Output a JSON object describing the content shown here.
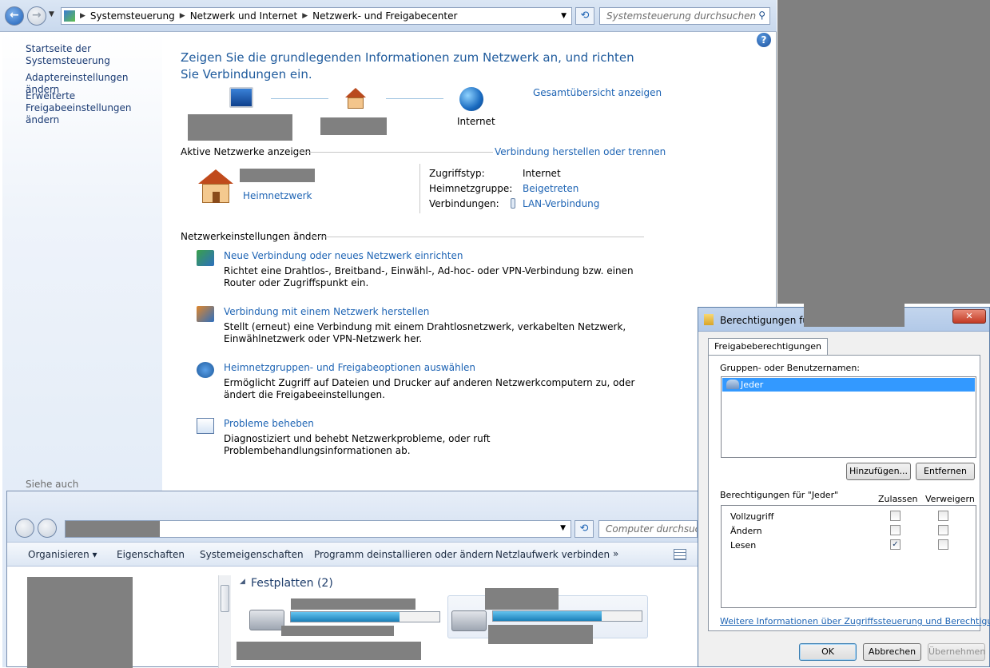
{
  "addressbar": {
    "crumbs": [
      "Systemsteuerung",
      "Netzwerk und Internet",
      "Netzwerk- und Freigabecenter"
    ],
    "search_placeholder": "Systemsteuerung durchsuchen"
  },
  "sidebar": {
    "items": [
      {
        "label": "Startseite der Systemsteuerung"
      },
      {
        "label": "Adaptereinstellungen ändern"
      },
      {
        "label": "Erweiterte\nFreigabeeinstellungen ändern"
      }
    ],
    "see_also_label": "Siehe auch"
  },
  "main": {
    "heading": "Zeigen Sie die grundlegenden Informationen zum Netzwerk an, und richten Sie Verbindungen ein.",
    "map_internet_label": "Internet",
    "map_overview_link": "Gesamtübersicht anzeigen",
    "active_networks_header": "Aktive Netzwerke anzeigen",
    "connect_link": "Verbindung herstellen oder trennen",
    "network_type": "Heimnetzwerk",
    "details": {
      "access_type_label": "Zugriffstyp:",
      "access_type_value": "Internet",
      "homegroup_label": "Heimnetzgruppe:",
      "homegroup_value": "Beigetreten",
      "connections_label": "Verbindungen:",
      "connections_value": "LAN-Verbindung"
    },
    "settings_header": "Netzwerkeinstellungen ändern",
    "tasks": [
      {
        "title": "Neue Verbindung oder neues Netzwerk einrichten",
        "desc": "Richtet eine Drahtlos-, Breitband-, Einwähl-, Ad-hoc- oder VPN-Verbindung bzw. einen Router oder Zugriffspunkt ein."
      },
      {
        "title": "Verbindung mit einem Netzwerk herstellen",
        "desc": "Stellt (erneut) eine Verbindung mit einem Drahtlosnetzwerk, verkabelten Netzwerk, Einwählnetzwerk oder VPN-Netzwerk her."
      },
      {
        "title": "Heimnetzgruppen- und Freigabeoptionen auswählen",
        "desc": "Ermöglicht Zugriff auf Dateien und Drucker auf anderen Netzwerkcomputern zu, oder ändert die Freigabeeinstellungen."
      },
      {
        "title": "Probleme beheben",
        "desc": "Diagnostiziert und behebt Netzwerkprobleme, oder ruft Problembehandlungsinformationen ab."
      }
    ]
  },
  "explorer": {
    "search_placeholder": "Computer durchsuchen",
    "toolbar": [
      "Organisieren ▾",
      "Eigenschaften",
      "Systemeigenschaften",
      "Programm deinstallieren oder ändern",
      "Netzlaufwerk verbinden",
      "»"
    ],
    "section_title": "Festplatten (2)",
    "drive1_fill": 0.73,
    "drive2_fill": 0.73
  },
  "dialog": {
    "title": "Berechtigungen für",
    "close_glyph": "✕",
    "tab": "Freigabeberechtigungen",
    "groups_label": "Gruppen- oder Benutzernamen:",
    "selected_user": "Jeder",
    "add_button": "Hinzufügen...",
    "remove_button": "Entfernen",
    "permissions_for": "Berechtigungen für \"Jeder\"",
    "allow_col": "Zulassen",
    "deny_col": "Verweigern",
    "permissions": [
      {
        "name": "Vollzugriff",
        "allow": false,
        "deny": false
      },
      {
        "name": "Ändern",
        "allow": false,
        "deny": false
      },
      {
        "name": "Lesen",
        "allow": true,
        "deny": false
      }
    ],
    "more_info_link": "Weitere Informationen über Zugriffssteuerung und Berechtigungen",
    "ok": "OK",
    "cancel": "Abbrechen",
    "apply": "Übernehmen"
  },
  "colors": {
    "accent": "#1e64b4",
    "heading": "#1e5a9c",
    "selection": "#3399ff",
    "redaction": "#808080"
  }
}
